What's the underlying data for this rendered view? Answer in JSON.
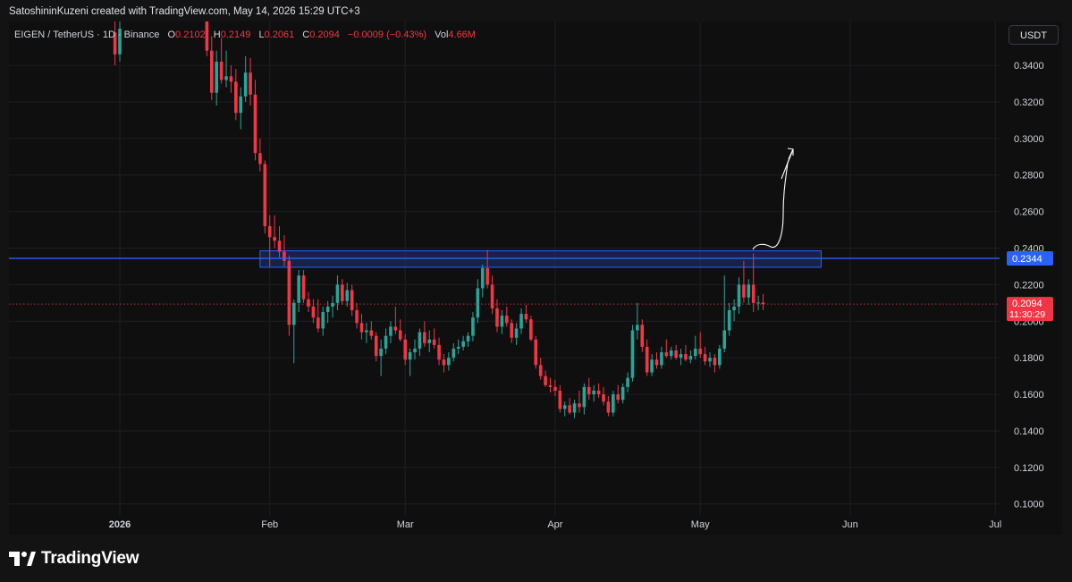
{
  "header": {
    "credit": "SatoshininKuzeni created with TradingView.com, May 14, 2026 15:29 UTC+3"
  },
  "legend": {
    "symbol": "EIGEN / TetherUS · 1D · Binance",
    "o_label": "O",
    "o_value": "0.2102",
    "h_label": "H",
    "h_value": "0.2149",
    "l_label": "L",
    "l_value": "0.2061",
    "c_label": "C",
    "c_value": "0.2094",
    "change": "−0.0009 (−0.43%)",
    "vol_label": "Vol",
    "vol_value": "4.66M"
  },
  "currency_button": "USDT",
  "logo_text": "TradingView",
  "colors": {
    "up": "#26a69a",
    "down": "#f23645",
    "level_line": "#2962ff",
    "zone_fill": "#1e3a8a",
    "current_price_line": "#f23645",
    "price_badge": "#f23645",
    "level_badge": "#2962ff"
  },
  "chart_data": {
    "type": "candlestick",
    "x_start_date": "2025-12-20",
    "y_axis": {
      "ylim": [
        0.094,
        0.364
      ],
      "ticks": [
        "0.3400",
        "0.3200",
        "0.3000",
        "0.2800",
        "0.2600",
        "0.2400",
        "0.2200",
        "0.2000",
        "0.1800",
        "0.1600",
        "0.1400",
        "0.1200",
        "0.1000"
      ]
    },
    "x_axis": {
      "labels": [
        {
          "date": "2026-01-01",
          "text": "2026",
          "bold": true
        },
        {
          "date": "2026-02-01",
          "text": "Feb"
        },
        {
          "date": "2026-03-01",
          "text": "Mar"
        },
        {
          "date": "2026-04-01",
          "text": "Apr"
        },
        {
          "date": "2026-05-01",
          "text": "May"
        },
        {
          "date": "2026-06-01",
          "text": "Jun"
        },
        {
          "date": "2026-07-01",
          "text": "Jul"
        }
      ]
    },
    "horizontal_level": {
      "value": 0.2344,
      "label": "0.2344"
    },
    "resistance_zone": {
      "from": "2026-01-30",
      "to": "2026-05-26",
      "low": 0.2295,
      "high": 0.2385
    },
    "current_price": {
      "value": 0.2094,
      "label": "0.2094",
      "countdown": "11:30:29"
    },
    "candles": [
      {
        "date": "2025-12-31",
        "o": 0.358,
        "h": 0.365,
        "l": 0.34,
        "c": 0.346
      },
      {
        "date": "2026-01-01",
        "o": 0.346,
        "h": 0.365,
        "l": 0.342,
        "c": 0.36
      },
      {
        "date": "2026-01-19",
        "o": 0.365,
        "h": 0.365,
        "l": 0.345,
        "c": 0.348
      },
      {
        "date": "2026-01-20",
        "o": 0.348,
        "h": 0.356,
        "l": 0.321,
        "c": 0.325
      },
      {
        "date": "2026-01-21",
        "o": 0.325,
        "h": 0.348,
        "l": 0.318,
        "c": 0.342
      },
      {
        "date": "2026-01-22",
        "o": 0.342,
        "h": 0.355,
        "l": 0.33,
        "c": 0.332
      },
      {
        "date": "2026-01-23",
        "o": 0.332,
        "h": 0.348,
        "l": 0.328,
        "c": 0.334
      },
      {
        "date": "2026-01-24",
        "o": 0.334,
        "h": 0.34,
        "l": 0.325,
        "c": 0.331
      },
      {
        "date": "2026-01-25",
        "o": 0.331,
        "h": 0.338,
        "l": 0.31,
        "c": 0.314
      },
      {
        "date": "2026-01-26",
        "o": 0.314,
        "h": 0.328,
        "l": 0.305,
        "c": 0.323
      },
      {
        "date": "2026-01-27",
        "o": 0.323,
        "h": 0.345,
        "l": 0.32,
        "c": 0.336
      },
      {
        "date": "2026-01-28",
        "o": 0.336,
        "h": 0.344,
        "l": 0.318,
        "c": 0.324
      },
      {
        "date": "2026-01-29",
        "o": 0.324,
        "h": 0.332,
        "l": 0.288,
        "c": 0.292
      },
      {
        "date": "2026-01-30",
        "o": 0.292,
        "h": 0.3,
        "l": 0.282,
        "c": 0.286
      },
      {
        "date": "2026-01-31",
        "o": 0.286,
        "h": 0.288,
        "l": 0.248,
        "c": 0.252
      },
      {
        "date": "2026-02-01",
        "o": 0.252,
        "h": 0.258,
        "l": 0.23,
        "c": 0.246
      },
      {
        "date": "2026-02-02",
        "o": 0.246,
        "h": 0.258,
        "l": 0.24,
        "c": 0.244
      },
      {
        "date": "2026-02-03",
        "o": 0.244,
        "h": 0.252,
        "l": 0.235,
        "c": 0.238
      },
      {
        "date": "2026-02-04",
        "o": 0.238,
        "h": 0.247,
        "l": 0.23,
        "c": 0.233
      },
      {
        "date": "2026-02-05",
        "o": 0.233,
        "h": 0.236,
        "l": 0.192,
        "c": 0.198
      },
      {
        "date": "2026-02-06",
        "o": 0.198,
        "h": 0.212,
        "l": 0.177,
        "c": 0.21
      },
      {
        "date": "2026-02-07",
        "o": 0.21,
        "h": 0.228,
        "l": 0.205,
        "c": 0.225
      },
      {
        "date": "2026-02-08",
        "o": 0.225,
        "h": 0.228,
        "l": 0.21,
        "c": 0.212
      },
      {
        "date": "2026-02-09",
        "o": 0.212,
        "h": 0.216,
        "l": 0.205,
        "c": 0.208
      },
      {
        "date": "2026-02-10",
        "o": 0.208,
        "h": 0.212,
        "l": 0.199,
        "c": 0.202
      },
      {
        "date": "2026-02-11",
        "o": 0.202,
        "h": 0.212,
        "l": 0.194,
        "c": 0.196
      },
      {
        "date": "2026-02-12",
        "o": 0.196,
        "h": 0.208,
        "l": 0.192,
        "c": 0.205
      },
      {
        "date": "2026-02-13",
        "o": 0.205,
        "h": 0.211,
        "l": 0.199,
        "c": 0.208
      },
      {
        "date": "2026-02-14",
        "o": 0.208,
        "h": 0.214,
        "l": 0.202,
        "c": 0.21
      },
      {
        "date": "2026-02-15",
        "o": 0.21,
        "h": 0.225,
        "l": 0.206,
        "c": 0.22
      },
      {
        "date": "2026-02-16",
        "o": 0.22,
        "h": 0.223,
        "l": 0.209,
        "c": 0.211
      },
      {
        "date": "2026-02-17",
        "o": 0.211,
        "h": 0.221,
        "l": 0.208,
        "c": 0.217
      },
      {
        "date": "2026-02-18",
        "o": 0.217,
        "h": 0.22,
        "l": 0.203,
        "c": 0.206
      },
      {
        "date": "2026-02-19",
        "o": 0.206,
        "h": 0.21,
        "l": 0.196,
        "c": 0.199
      },
      {
        "date": "2026-02-20",
        "o": 0.199,
        "h": 0.204,
        "l": 0.19,
        "c": 0.194
      },
      {
        "date": "2026-02-21",
        "o": 0.194,
        "h": 0.199,
        "l": 0.188,
        "c": 0.195
      },
      {
        "date": "2026-02-22",
        "o": 0.195,
        "h": 0.2,
        "l": 0.19,
        "c": 0.192
      },
      {
        "date": "2026-02-23",
        "o": 0.192,
        "h": 0.194,
        "l": 0.178,
        "c": 0.181
      },
      {
        "date": "2026-02-24",
        "o": 0.181,
        "h": 0.19,
        "l": 0.17,
        "c": 0.185
      },
      {
        "date": "2026-02-25",
        "o": 0.185,
        "h": 0.196,
        "l": 0.182,
        "c": 0.192
      },
      {
        "date": "2026-02-26",
        "o": 0.192,
        "h": 0.2,
        "l": 0.188,
        "c": 0.197
      },
      {
        "date": "2026-02-27",
        "o": 0.197,
        "h": 0.208,
        "l": 0.193,
        "c": 0.195
      },
      {
        "date": "2026-02-28",
        "o": 0.195,
        "h": 0.201,
        "l": 0.189,
        "c": 0.19
      },
      {
        "date": "2026-03-01",
        "o": 0.19,
        "h": 0.193,
        "l": 0.176,
        "c": 0.179
      },
      {
        "date": "2026-03-02",
        "o": 0.179,
        "h": 0.185,
        "l": 0.17,
        "c": 0.183
      },
      {
        "date": "2026-03-03",
        "o": 0.183,
        "h": 0.19,
        "l": 0.179,
        "c": 0.185
      },
      {
        "date": "2026-03-04",
        "o": 0.185,
        "h": 0.196,
        "l": 0.181,
        "c": 0.194
      },
      {
        "date": "2026-03-05",
        "o": 0.194,
        "h": 0.2,
        "l": 0.186,
        "c": 0.188
      },
      {
        "date": "2026-03-06",
        "o": 0.188,
        "h": 0.195,
        "l": 0.183,
        "c": 0.19
      },
      {
        "date": "2026-03-07",
        "o": 0.19,
        "h": 0.196,
        "l": 0.185,
        "c": 0.187
      },
      {
        "date": "2026-03-08",
        "o": 0.187,
        "h": 0.191,
        "l": 0.176,
        "c": 0.179
      },
      {
        "date": "2026-03-09",
        "o": 0.179,
        "h": 0.182,
        "l": 0.172,
        "c": 0.176
      },
      {
        "date": "2026-03-10",
        "o": 0.176,
        "h": 0.183,
        "l": 0.173,
        "c": 0.18
      },
      {
        "date": "2026-03-11",
        "o": 0.18,
        "h": 0.188,
        "l": 0.178,
        "c": 0.185
      },
      {
        "date": "2026-03-12",
        "o": 0.185,
        "h": 0.19,
        "l": 0.182,
        "c": 0.186
      },
      {
        "date": "2026-03-13",
        "o": 0.186,
        "h": 0.192,
        "l": 0.184,
        "c": 0.189
      },
      {
        "date": "2026-03-14",
        "o": 0.189,
        "h": 0.194,
        "l": 0.186,
        "c": 0.192
      },
      {
        "date": "2026-03-15",
        "o": 0.192,
        "h": 0.205,
        "l": 0.189,
        "c": 0.202
      },
      {
        "date": "2026-03-16",
        "o": 0.202,
        "h": 0.223,
        "l": 0.199,
        "c": 0.218
      },
      {
        "date": "2026-03-17",
        "o": 0.218,
        "h": 0.231,
        "l": 0.213,
        "c": 0.229
      },
      {
        "date": "2026-03-18",
        "o": 0.229,
        "h": 0.239,
        "l": 0.218,
        "c": 0.22
      },
      {
        "date": "2026-03-19",
        "o": 0.22,
        "h": 0.225,
        "l": 0.204,
        "c": 0.207
      },
      {
        "date": "2026-03-20",
        "o": 0.207,
        "h": 0.212,
        "l": 0.194,
        "c": 0.197
      },
      {
        "date": "2026-03-21",
        "o": 0.197,
        "h": 0.206,
        "l": 0.193,
        "c": 0.203
      },
      {
        "date": "2026-03-22",
        "o": 0.203,
        "h": 0.208,
        "l": 0.197,
        "c": 0.199
      },
      {
        "date": "2026-03-23",
        "o": 0.199,
        "h": 0.201,
        "l": 0.188,
        "c": 0.191
      },
      {
        "date": "2026-03-24",
        "o": 0.191,
        "h": 0.199,
        "l": 0.187,
        "c": 0.196
      },
      {
        "date": "2026-03-25",
        "o": 0.196,
        "h": 0.207,
        "l": 0.193,
        "c": 0.204
      },
      {
        "date": "2026-03-26",
        "o": 0.204,
        "h": 0.209,
        "l": 0.199,
        "c": 0.201
      },
      {
        "date": "2026-03-27",
        "o": 0.201,
        "h": 0.203,
        "l": 0.189,
        "c": 0.19
      },
      {
        "date": "2026-03-28",
        "o": 0.19,
        "h": 0.192,
        "l": 0.174,
        "c": 0.176
      },
      {
        "date": "2026-03-29",
        "o": 0.176,
        "h": 0.18,
        "l": 0.168,
        "c": 0.17
      },
      {
        "date": "2026-03-30",
        "o": 0.17,
        "h": 0.173,
        "l": 0.164,
        "c": 0.165
      },
      {
        "date": "2026-03-31",
        "o": 0.165,
        "h": 0.169,
        "l": 0.161,
        "c": 0.164
      },
      {
        "date": "2026-04-01",
        "o": 0.164,
        "h": 0.168,
        "l": 0.159,
        "c": 0.162
      },
      {
        "date": "2026-04-02",
        "o": 0.162,
        "h": 0.165,
        "l": 0.15,
        "c": 0.152
      },
      {
        "date": "2026-04-03",
        "o": 0.152,
        "h": 0.156,
        "l": 0.148,
        "c": 0.154
      },
      {
        "date": "2026-04-04",
        "o": 0.154,
        "h": 0.158,
        "l": 0.149,
        "c": 0.15
      },
      {
        "date": "2026-04-05",
        "o": 0.15,
        "h": 0.157,
        "l": 0.147,
        "c": 0.155
      },
      {
        "date": "2026-04-06",
        "o": 0.155,
        "h": 0.162,
        "l": 0.15,
        "c": 0.153
      },
      {
        "date": "2026-04-07",
        "o": 0.153,
        "h": 0.166,
        "l": 0.149,
        "c": 0.164
      },
      {
        "date": "2026-04-08",
        "o": 0.164,
        "h": 0.169,
        "l": 0.157,
        "c": 0.16
      },
      {
        "date": "2026-04-09",
        "o": 0.16,
        "h": 0.165,
        "l": 0.156,
        "c": 0.162
      },
      {
        "date": "2026-04-10",
        "o": 0.162,
        "h": 0.166,
        "l": 0.158,
        "c": 0.16
      },
      {
        "date": "2026-04-11",
        "o": 0.16,
        "h": 0.164,
        "l": 0.154,
        "c": 0.156
      },
      {
        "date": "2026-04-12",
        "o": 0.156,
        "h": 0.159,
        "l": 0.148,
        "c": 0.15
      },
      {
        "date": "2026-04-13",
        "o": 0.15,
        "h": 0.162,
        "l": 0.148,
        "c": 0.16
      },
      {
        "date": "2026-04-14",
        "o": 0.16,
        "h": 0.165,
        "l": 0.155,
        "c": 0.157
      },
      {
        "date": "2026-04-15",
        "o": 0.157,
        "h": 0.166,
        "l": 0.155,
        "c": 0.164
      },
      {
        "date": "2026-04-16",
        "o": 0.164,
        "h": 0.172,
        "l": 0.161,
        "c": 0.169
      },
      {
        "date": "2026-04-17",
        "o": 0.169,
        "h": 0.198,
        "l": 0.167,
        "c": 0.195
      },
      {
        "date": "2026-04-18",
        "o": 0.195,
        "h": 0.21,
        "l": 0.19,
        "c": 0.198
      },
      {
        "date": "2026-04-19",
        "o": 0.198,
        "h": 0.201,
        "l": 0.183,
        "c": 0.186
      },
      {
        "date": "2026-04-20",
        "o": 0.186,
        "h": 0.19,
        "l": 0.17,
        "c": 0.172
      },
      {
        "date": "2026-04-21",
        "o": 0.172,
        "h": 0.182,
        "l": 0.17,
        "c": 0.179
      },
      {
        "date": "2026-04-22",
        "o": 0.179,
        "h": 0.183,
        "l": 0.174,
        "c": 0.176
      },
      {
        "date": "2026-04-23",
        "o": 0.176,
        "h": 0.186,
        "l": 0.174,
        "c": 0.183
      },
      {
        "date": "2026-04-24",
        "o": 0.183,
        "h": 0.19,
        "l": 0.18,
        "c": 0.181
      },
      {
        "date": "2026-04-25",
        "o": 0.181,
        "h": 0.186,
        "l": 0.179,
        "c": 0.184
      },
      {
        "date": "2026-04-26",
        "o": 0.184,
        "h": 0.187,
        "l": 0.179,
        "c": 0.18
      },
      {
        "date": "2026-04-27",
        "o": 0.18,
        "h": 0.185,
        "l": 0.176,
        "c": 0.182
      },
      {
        "date": "2026-04-28",
        "o": 0.182,
        "h": 0.187,
        "l": 0.178,
        "c": 0.179
      },
      {
        "date": "2026-04-29",
        "o": 0.179,
        "h": 0.184,
        "l": 0.177,
        "c": 0.181
      },
      {
        "date": "2026-04-30",
        "o": 0.181,
        "h": 0.192,
        "l": 0.179,
        "c": 0.185
      },
      {
        "date": "2026-05-01",
        "o": 0.185,
        "h": 0.194,
        "l": 0.18,
        "c": 0.182
      },
      {
        "date": "2026-05-02",
        "o": 0.182,
        "h": 0.186,
        "l": 0.176,
        "c": 0.178
      },
      {
        "date": "2026-05-03",
        "o": 0.178,
        "h": 0.183,
        "l": 0.175,
        "c": 0.18
      },
      {
        "date": "2026-05-04",
        "o": 0.18,
        "h": 0.182,
        "l": 0.172,
        "c": 0.176
      },
      {
        "date": "2026-05-05",
        "o": 0.176,
        "h": 0.187,
        "l": 0.174,
        "c": 0.185
      },
      {
        "date": "2026-05-06",
        "o": 0.185,
        "h": 0.225,
        "l": 0.183,
        "c": 0.195
      },
      {
        "date": "2026-05-07",
        "o": 0.195,
        "h": 0.21,
        "l": 0.192,
        "c": 0.206
      },
      {
        "date": "2026-05-08",
        "o": 0.206,
        "h": 0.212,
        "l": 0.2,
        "c": 0.208
      },
      {
        "date": "2026-05-09",
        "o": 0.208,
        "h": 0.224,
        "l": 0.204,
        "c": 0.22
      },
      {
        "date": "2026-05-10",
        "o": 0.22,
        "h": 0.233,
        "l": 0.21,
        "c": 0.213
      },
      {
        "date": "2026-05-11",
        "o": 0.213,
        "h": 0.223,
        "l": 0.209,
        "c": 0.22
      },
      {
        "date": "2026-05-12",
        "o": 0.22,
        "h": 0.237,
        "l": 0.205,
        "c": 0.21
      },
      {
        "date": "2026-05-13",
        "o": 0.21,
        "h": 0.214,
        "l": 0.206,
        "c": 0.2102
      },
      {
        "date": "2026-05-14",
        "o": 0.2102,
        "h": 0.2149,
        "l": 0.2061,
        "c": 0.2094
      }
    ]
  }
}
